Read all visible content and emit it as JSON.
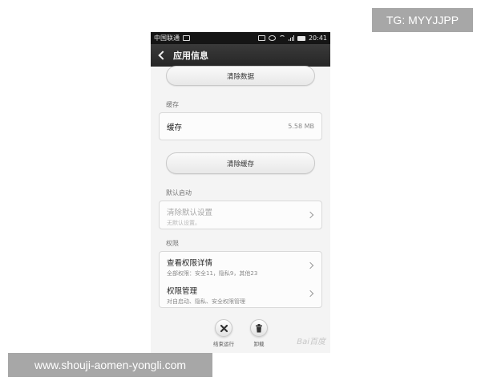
{
  "status_bar": {
    "carrier": "中国联通",
    "time": "20:41"
  },
  "header": {
    "title": "应用信息"
  },
  "buttons": {
    "clear_data": "清除数据",
    "clear_cache": "清除缓存"
  },
  "cache_section": {
    "label": "缓存",
    "row_title": "缓存",
    "row_value": "5.58 MB"
  },
  "default_launch_section": {
    "label": "默认启动",
    "row_title": "清除默认设置",
    "row_sub": "无默认设置。"
  },
  "permissions_section": {
    "label": "权限",
    "items": [
      {
        "title": "查看权限详情",
        "sub": "全部权限：安全11，隐私9，其他23"
      },
      {
        "title": "权限管理",
        "sub": "对自启动、隐私、安全权限管理"
      }
    ]
  },
  "bottom_actions": {
    "force_stop": "结束运行",
    "uninstall": "卸载"
  },
  "overlays": {
    "tg_badge": "TG: MYYJJPP",
    "url_badge": "www.shouji-aomen-yongli.com",
    "watermark": "Bai百度"
  }
}
